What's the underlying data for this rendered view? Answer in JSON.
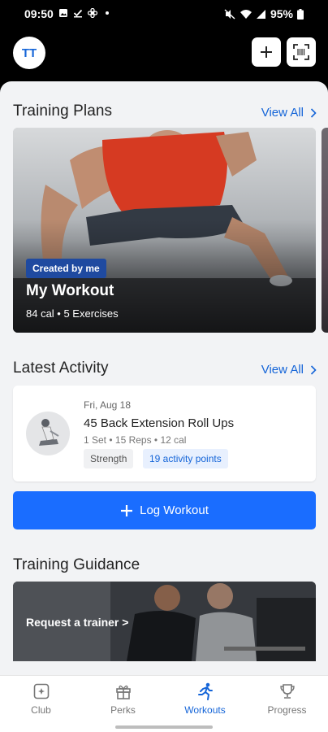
{
  "status_bar": {
    "time": "09:50",
    "battery": "95%"
  },
  "header": {
    "avatar_initials": "TT"
  },
  "training_plans": {
    "title": "Training Plans",
    "view_all": "View All",
    "card": {
      "badge": "Created by me",
      "name": "My Workout",
      "meta": "84 cal • 5 Exercises"
    }
  },
  "latest_activity": {
    "title": "Latest Activity",
    "view_all": "View All",
    "item": {
      "date": "Fri, Aug 18",
      "name": "45 Back Extension Roll Ups",
      "meta": "1 Set • 15 Reps • 12 cal",
      "tags": [
        "Strength",
        "19 activity points"
      ]
    }
  },
  "log_workout": {
    "label": "Log Workout"
  },
  "training_guidance": {
    "title": "Training Guidance",
    "card_text": "Request a trainer >"
  },
  "bottom_nav": {
    "items": [
      {
        "label": "Club",
        "icon": "club-icon"
      },
      {
        "label": "Perks",
        "icon": "gift-icon"
      },
      {
        "label": "Workouts",
        "icon": "runner-icon",
        "active": true
      },
      {
        "label": "Progress",
        "icon": "trophy-icon"
      }
    ]
  },
  "colors": {
    "accent": "#1a6dff",
    "link": "#1565d8",
    "badge": "#1f4aa0",
    "background": "#f2f3f5"
  }
}
